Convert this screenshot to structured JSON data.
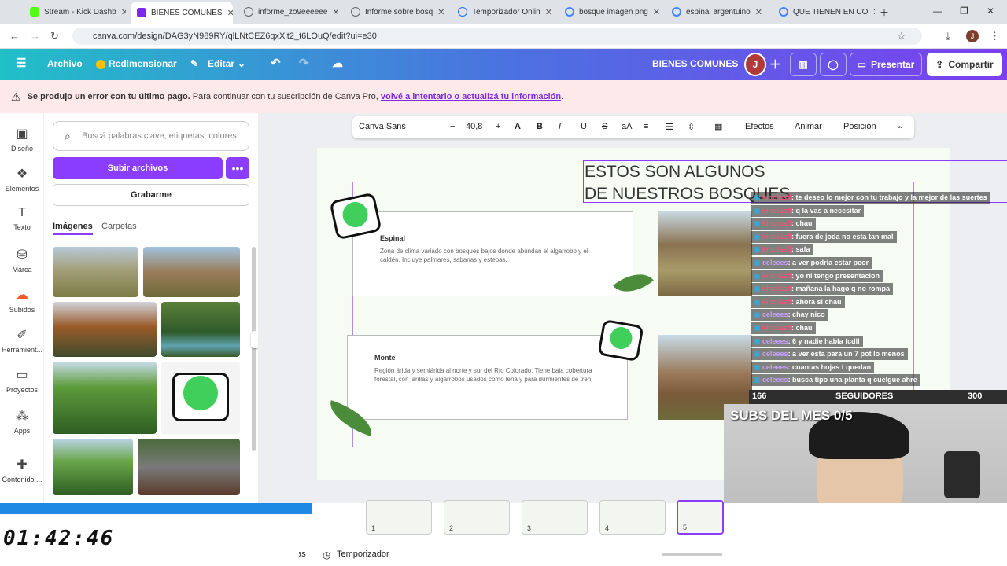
{
  "browser": {
    "tabs": [
      {
        "label": "Stream - Kick Dashb",
        "color": "#53fc18"
      },
      {
        "label": "BIENES COMUNES",
        "color": "#7d2ae8"
      },
      {
        "label": "informe_zo9eeeeee",
        "color": "#666666"
      },
      {
        "label": "Informe sobre bosq",
        "color": "#666666"
      },
      {
        "label": "Temporizador Onlin",
        "color": "#1a73e8"
      },
      {
        "label": "bosque imagen png",
        "color": "#4285f4"
      },
      {
        "label": "espinal argentuino",
        "color": "#4285f4"
      },
      {
        "label": "QUE TIENEN EN CO",
        "color": "#4285f4"
      }
    ],
    "url": "canva.com/design/DAG3yN989RY/qlLNtCEZ6qxXlt2_t6LOuQ/edit?ui=e30"
  },
  "toolbar": {
    "file": "Archivo",
    "resize": "Redimensionar",
    "edit": "Editar",
    "design_title": "BIENES COMUNES",
    "avatar": "J",
    "present": "Presentar",
    "share": "Compartir"
  },
  "alert": {
    "bold": "Se produjo un error con tu último pago.",
    "text": "Para continuar con tu suscripción de Canva Pro,",
    "link": "volvé a intentarlo o actualizá tu información",
    "end": "."
  },
  "rail": [
    {
      "label": "Diseño",
      "icon": "layout-icon"
    },
    {
      "label": "Elementos",
      "icon": "shapes-icon"
    },
    {
      "label": "Texto",
      "icon": "text-icon"
    },
    {
      "label": "Marca",
      "icon": "brand-icon"
    },
    {
      "label": "Subidos",
      "icon": "upload-cloud-icon"
    },
    {
      "label": "Herramient...",
      "icon": "tools-icon"
    },
    {
      "label": "Proyectos",
      "icon": "folder-icon"
    },
    {
      "label": "Apps",
      "icon": "apps-icon"
    },
    {
      "label": "Contenido ...",
      "icon": "content-icon"
    }
  ],
  "panel": {
    "search_placeholder": "Buscá palabras clave, etiquetas, colores",
    "upload": "Subir archivos",
    "record": "Grabarme",
    "tab_images": "Imágenes",
    "tab_folders": "Carpetas"
  },
  "text_toolbar": {
    "font": "Canva Sans",
    "size": "40,8",
    "effects": "Efectos",
    "animate": "Animar",
    "position": "Posición"
  },
  "slide": {
    "title_line1": "ESTOS SON ALGUNOS",
    "title_line2": "DE NUESTROS BOSQUES",
    "card1_title": "Espinal",
    "card1_desc": "Zona de clima variado con bosques bajos donde abundan el algarrobo y el caldén. Incluye palmares, sabanas y estepas.",
    "card2_title": "Monte",
    "card2_desc": "Región árida y semiárida al norte y sur del Río Colorado. Tiene baja cobertura forestal, con jarillas y algarrobos usados como leña y para durmientes de tren"
  },
  "chat": [
    {
      "user": "kinolasff",
      "msg": ": te deseo lo mejor con tu trabajo y la mejor de las suertes",
      "color": "#ff4d7a"
    },
    {
      "user": "kinolasff",
      "msg": ": q la vas a necesitar",
      "color": "#ff4d7a"
    },
    {
      "user": "kinolasff",
      "msg": ": chau",
      "color": "#ff4d7a"
    },
    {
      "user": "kinolasff",
      "msg": ": fuera de joda no esta tan mal",
      "color": "#ff4d7a"
    },
    {
      "user": "kinolasff",
      "msg": ": safa",
      "color": "#ff4d7a"
    },
    {
      "user": "celeees",
      "msg": ": a ver podria estar peor",
      "color": "#c9a0ff"
    },
    {
      "user": "kinolasff",
      "msg": ": yo ni tengo presentacion",
      "color": "#ff4d7a"
    },
    {
      "user": "kinolasff",
      "msg": ": mañana la hago q no rompa",
      "color": "#ff4d7a"
    },
    {
      "user": "kinolasff",
      "msg": ": ahora si chau",
      "color": "#ff4d7a"
    },
    {
      "user": "celeees",
      "msg": ": chay nico",
      "color": "#c9a0ff"
    },
    {
      "user": "kinolasff",
      "msg": ": chau",
      "color": "#ff4d7a"
    },
    {
      "user": "celeees",
      "msg": ": 6 y nadie habla fcdll",
      "color": "#c9a0ff"
    },
    {
      "user": "celeees",
      "msg": ": a ver esta para un 7 pot lo menos",
      "color": "#c9a0ff"
    },
    {
      "user": "celeees",
      "msg": ": cuantas hojas t quedan",
      "color": "#c9a0ff"
    },
    {
      "user": "celeees",
      "msg": ": busca tipo una planta q cuelgue ahre",
      "color": "#c9a0ff"
    }
  ],
  "followers": {
    "current": "166",
    "label": "SEGUIDORES",
    "goal": "300"
  },
  "subs": "SUBS DEL MES 0/5",
  "pages": [
    "1",
    "2",
    "3",
    "4",
    "5"
  ],
  "bottom": {
    "notes": "Notas",
    "timer": "Temporizador"
  },
  "overlay_timer": "01:42:46"
}
